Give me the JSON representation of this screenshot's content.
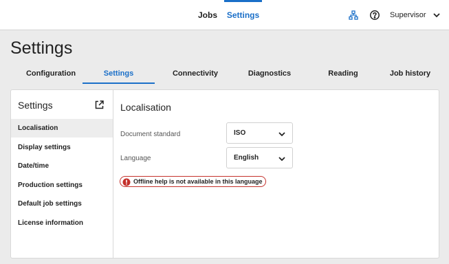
{
  "topbar": {
    "nav": [
      "Jobs",
      "Settings"
    ],
    "active_nav": "Settings",
    "user": "Supervisor",
    "icons": [
      "network-icon",
      "help-icon",
      "chevron-down-icon"
    ]
  },
  "page": {
    "title": "Settings"
  },
  "tabs": [
    {
      "label": "Configuration",
      "active": false
    },
    {
      "label": "Settings",
      "active": true
    },
    {
      "label": "Connectivity",
      "active": false
    },
    {
      "label": "Diagnostics",
      "active": false
    },
    {
      "label": "Reading",
      "active": false
    },
    {
      "label": "Job history",
      "active": false
    }
  ],
  "sidebar": {
    "title": "Settings",
    "items": [
      {
        "label": "Localisation",
        "active": true
      },
      {
        "label": "Display settings",
        "active": false
      },
      {
        "label": "Date/time",
        "active": false
      },
      {
        "label": "Production settings",
        "active": false
      },
      {
        "label": "Default job settings",
        "active": false
      },
      {
        "label": "License information",
        "active": false
      }
    ]
  },
  "main": {
    "title": "Localisation",
    "fields": [
      {
        "label": "Document standard",
        "value": "ISO"
      },
      {
        "label": "Language",
        "value": "English"
      }
    ],
    "warning": "Offline help is not available in this language"
  },
  "colors": {
    "accent": "#1a6fc8",
    "warning": "#c4302b",
    "background": "#ebebeb"
  }
}
